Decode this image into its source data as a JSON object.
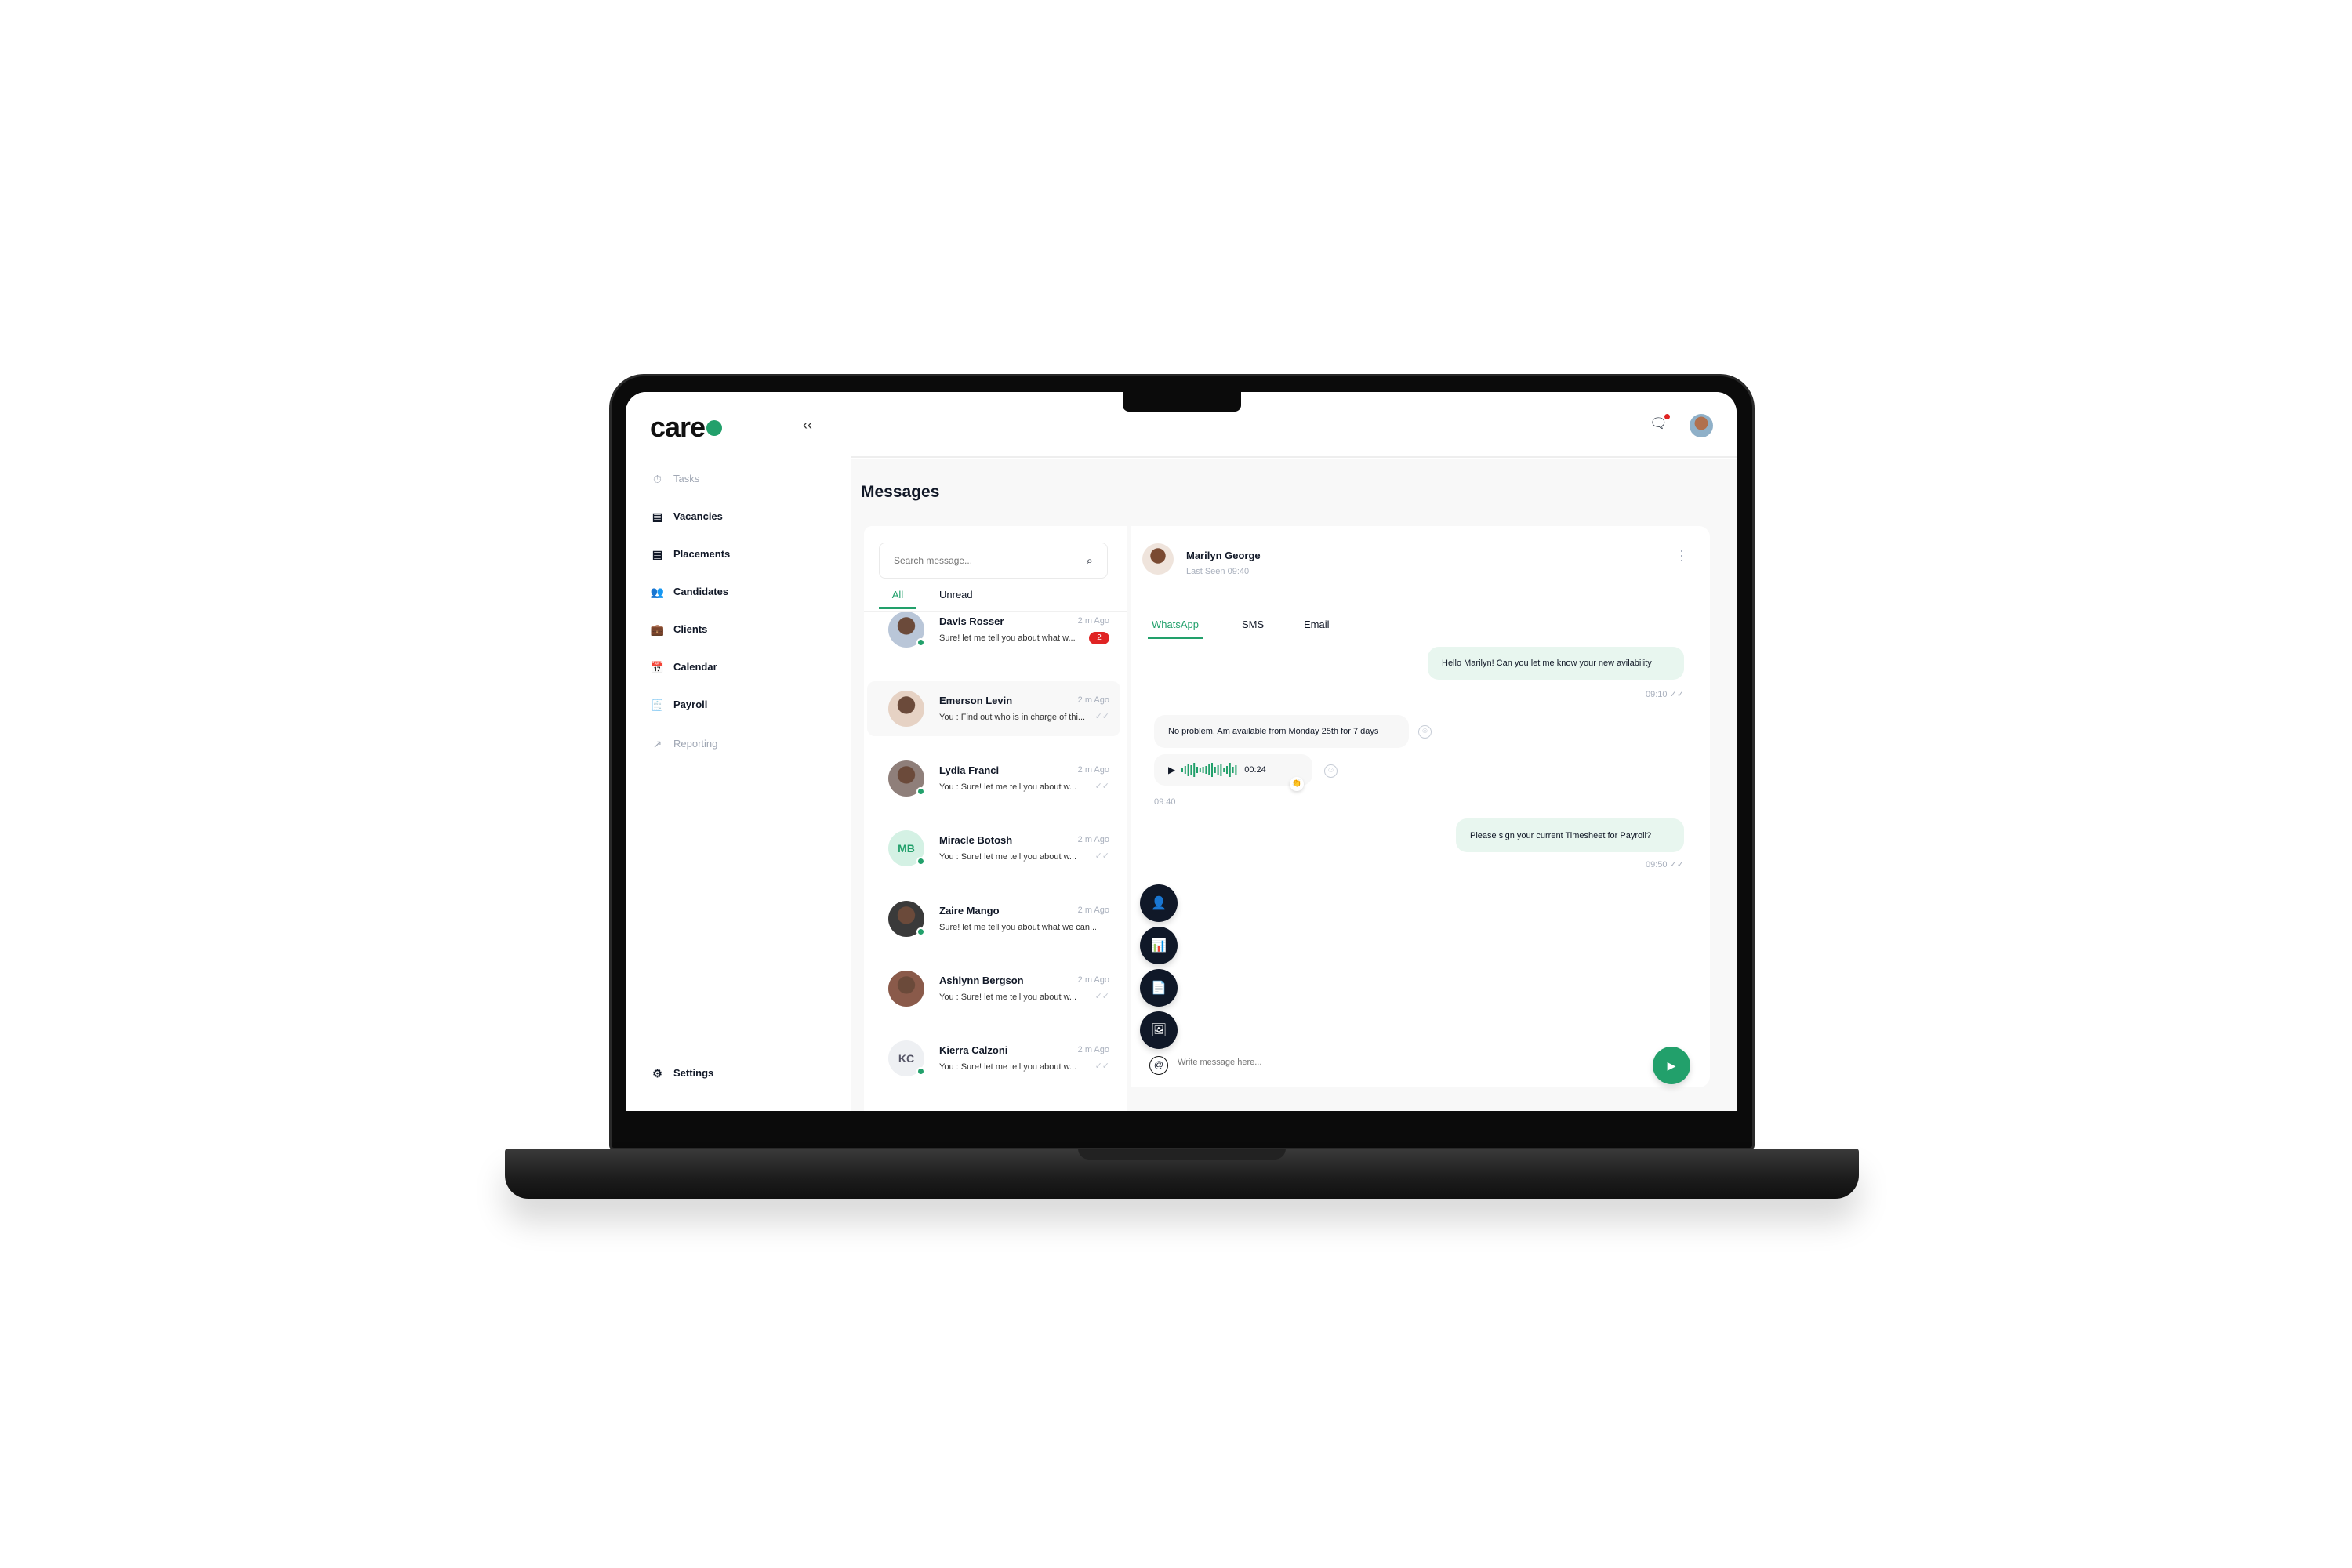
{
  "app": {
    "logo": "care"
  },
  "sidebar": {
    "collapse": "‹‹",
    "items": [
      {
        "label": "Tasks",
        "icon": "stopwatch-icon",
        "glyph": "⏱",
        "dim": true
      },
      {
        "label": "Vacancies",
        "icon": "clipboard-icon",
        "glyph": "▤"
      },
      {
        "label": "Placements",
        "icon": "clipboard-icon",
        "glyph": "▤"
      },
      {
        "label": "Candidates",
        "icon": "users-icon",
        "glyph": "👥"
      },
      {
        "label": "Clients",
        "icon": "briefcase-icon",
        "glyph": "💼"
      },
      {
        "label": "Calendar",
        "icon": "calendar-icon",
        "glyph": "📅"
      },
      {
        "label": "Payroll",
        "icon": "payroll-icon",
        "glyph": "🧾"
      },
      {
        "label": "Reporting",
        "icon": "trend-icon",
        "glyph": "↗",
        "dim": true
      }
    ],
    "settings": "Settings"
  },
  "page": {
    "title": "Messages"
  },
  "search": {
    "placeholder": "Search message..."
  },
  "list_tabs": [
    "All",
    "Unread"
  ],
  "conversations": [
    {
      "name": "Davis Rosser",
      "time": "2 m Ago",
      "preview": "Sure! let me tell you about what w...",
      "unread": "2",
      "online": true,
      "color": "#b9c6d8"
    },
    {
      "name": "Emerson Levin",
      "time": "2 m Ago",
      "preview": "You : Find out who is in charge of thi...",
      "online": false,
      "selected": true,
      "color": "#e6d2c4"
    },
    {
      "name": "Lydia Franci",
      "time": "2 m Ago",
      "preview": "You : Sure! let me tell you about w...",
      "online": true,
      "color": "#8f7f7a"
    },
    {
      "name": "Miracle Botosh",
      "time": "2 m Ago",
      "preview": "You : Sure! let me tell you about w...",
      "online": true,
      "initials": "MB",
      "color": "#d4f1e4"
    },
    {
      "name": "Zaire Mango",
      "time": "2 m Ago",
      "preview": "Sure! let me tell you about what we can...",
      "online": true,
      "color": "#3a3a3a"
    },
    {
      "name": "Ashlynn Bergson",
      "time": "2 m Ago",
      "preview": "You : Sure! let me tell you about w...",
      "online": false,
      "color": "#8a5a4a"
    },
    {
      "name": "Kierra Calzoni",
      "time": "2 m Ago",
      "preview": "You : Sure! let me tell you about w...",
      "online": true,
      "initials": "KC",
      "color": "#eef0f3"
    }
  ],
  "chat": {
    "name": "Marilyn George",
    "last_seen": "Last Seen 09:40",
    "tabs": [
      "WhatsApp",
      "SMS",
      "Email"
    ],
    "messages": [
      {
        "text": "Hello Marilyn! Can you let me know your new avilability",
        "time": "09:10"
      },
      {
        "text": "No problem. Am available from Monday 25th for 7 days"
      },
      {
        "audio_duration": "00:24",
        "time": "09:40",
        "reaction": "👏"
      },
      {
        "text": "Please sign your current Timesheet for Payroll?",
        "time": "09:50"
      }
    ],
    "placeholder": "Write message here..."
  },
  "colors": {
    "accent": "#22a06b",
    "badge": "#e02424",
    "dark": "#101828"
  }
}
